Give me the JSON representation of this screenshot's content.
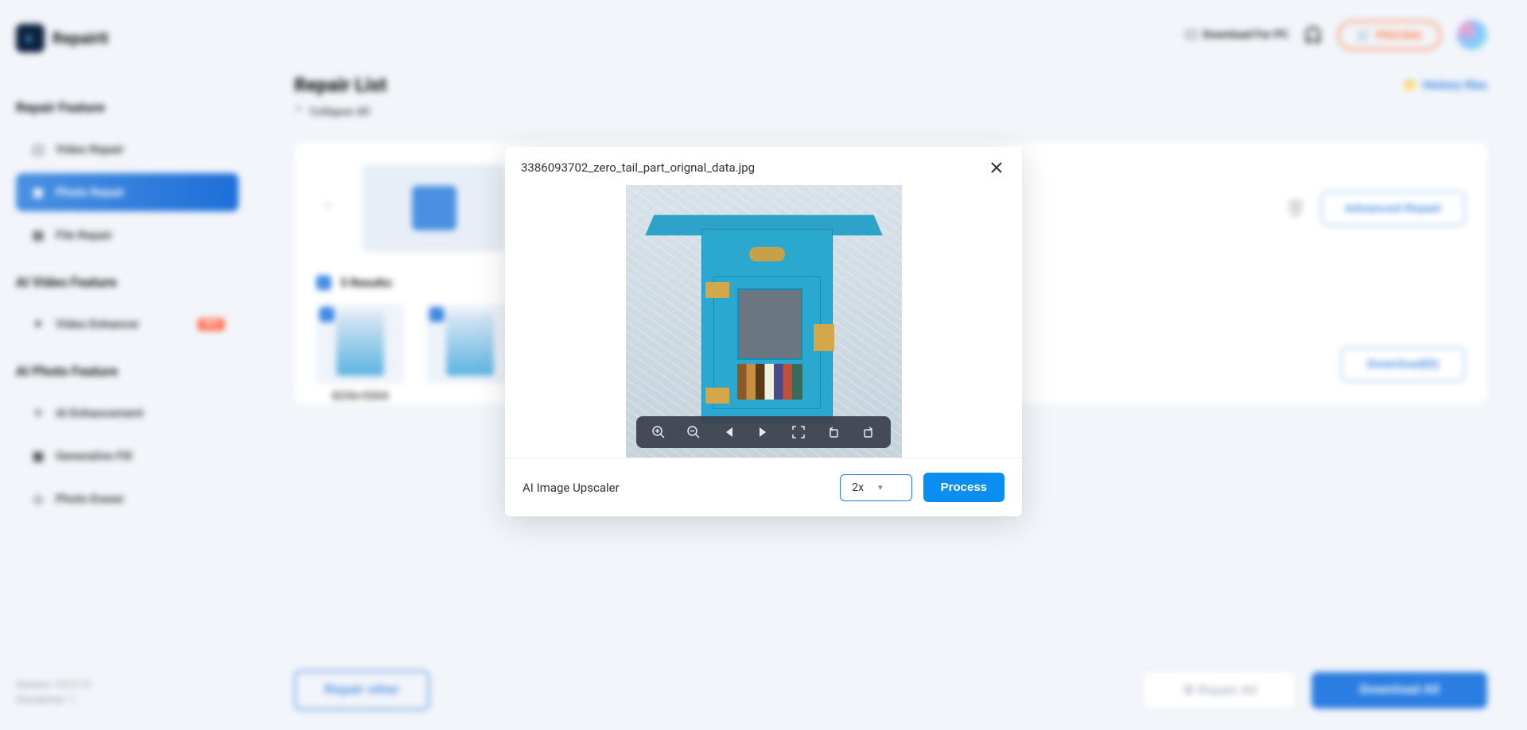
{
  "brand": {
    "name": "Repairit"
  },
  "topbar": {
    "download_pc": "Download For PC",
    "pricing": "PRICING"
  },
  "sidebar": {
    "sections": {
      "repair_feature": "Repair Feature",
      "ai_video_feature": "AI Video Feature",
      "ai_photo_feature": "AI Photo Feature"
    },
    "items": {
      "video_repair": "Video Repair",
      "photo_repair": "Photo Repair",
      "file_repair": "File Repair",
      "video_enhancer": "Video Enhancer",
      "ai_enhancement": "AI Enhancement",
      "generative_fill": "Generative Fill",
      "photo_eraser": "Photo Eraser"
    },
    "new_badge": "NEW"
  },
  "content": {
    "title": "Repair List",
    "history": "History files",
    "collapse_all": "Collapse All",
    "advanced_repair": "Advanced Repair",
    "results_label": "5 Results:",
    "thumb_caption1": "8256×5504",
    "download_count": "Download(5)"
  },
  "footer": {
    "version": "Version: V3.0.12",
    "disclaimer": "Disclaimer",
    "repair_other": "Repair other",
    "repair_all": "Repair All",
    "download_all": "Download All"
  },
  "modal": {
    "filename": "3386093702_zero_tail_part_orignal_data.jpg",
    "upscaler_label": "AI Image Upscaler",
    "scale_value": "2x",
    "process": "Process"
  }
}
